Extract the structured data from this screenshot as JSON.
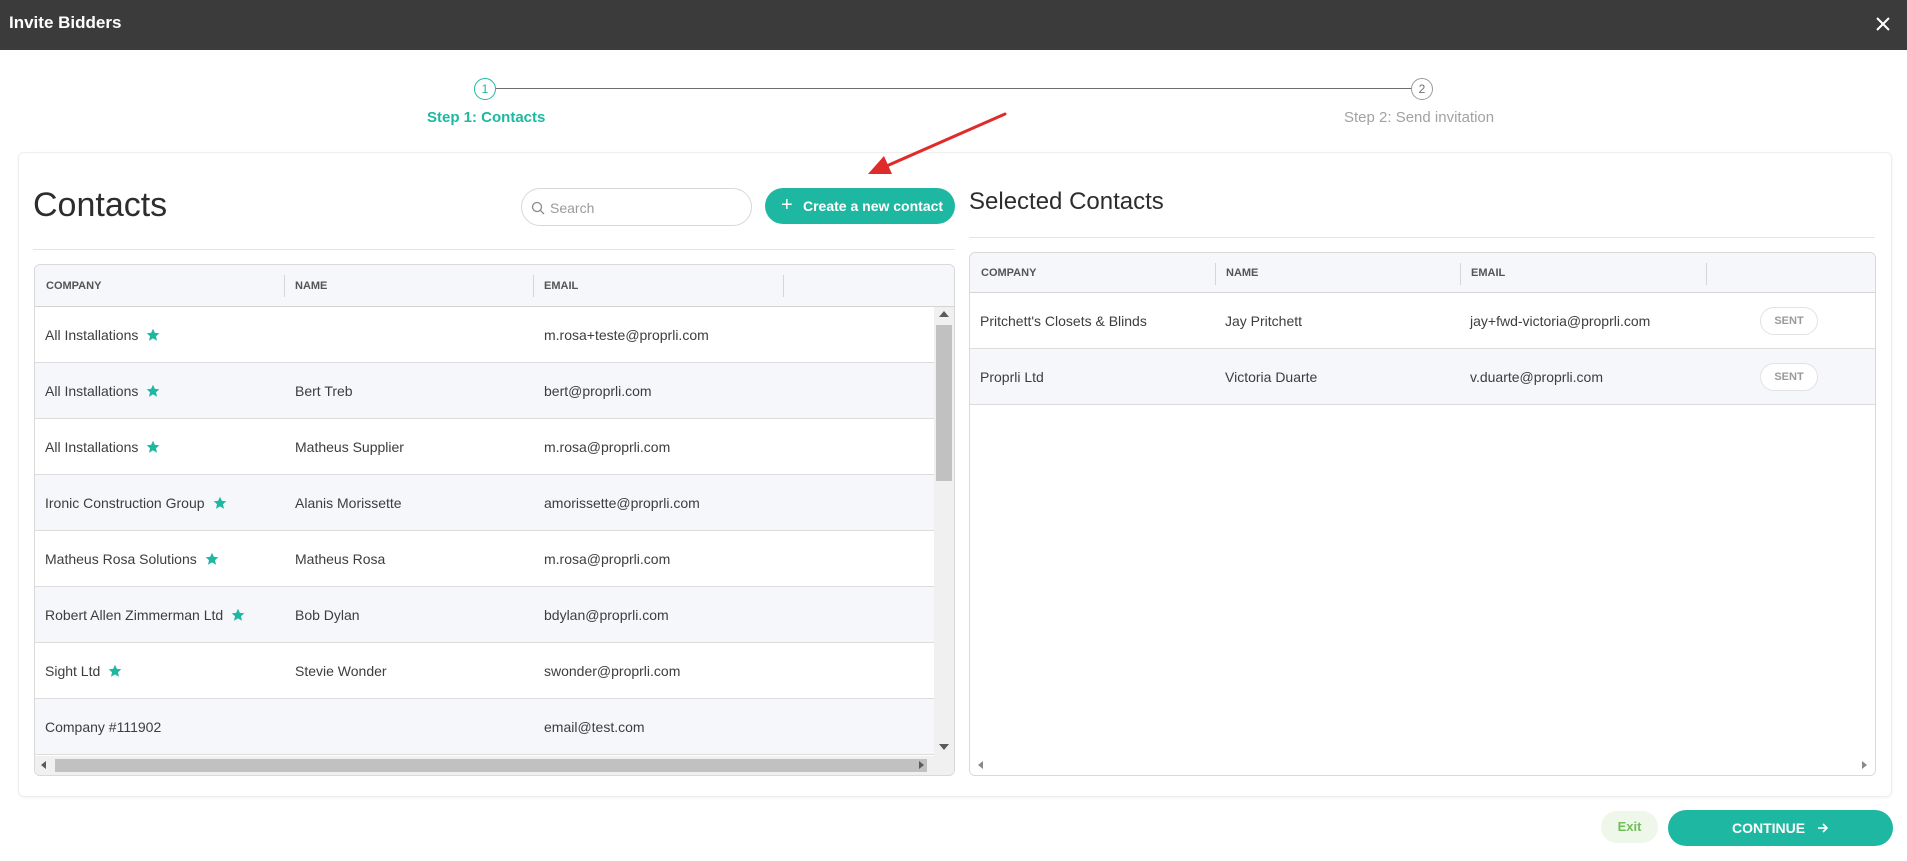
{
  "window": {
    "title": "Invite Bidders"
  },
  "stepper": {
    "steps": [
      {
        "number": "1",
        "label": "Step 1: Contacts",
        "active": true
      },
      {
        "number": "2",
        "label": "Step 2: Send invitation",
        "active": false
      }
    ]
  },
  "contacts": {
    "title": "Contacts",
    "search_placeholder": "Search",
    "create_button_label": "Create a new contact",
    "columns": [
      "COMPANY",
      "NAME",
      "EMAIL"
    ],
    "rows": [
      {
        "company": "All Installations",
        "starred": true,
        "name": "",
        "email": "m.rosa+teste@proprli.com"
      },
      {
        "company": "All Installations",
        "starred": true,
        "name": "Bert Treb",
        "email": "bert@proprli.com"
      },
      {
        "company": "All Installations",
        "starred": true,
        "name": "Matheus Supplier",
        "email": "m.rosa@proprli.com"
      },
      {
        "company": "Ironic Construction Group",
        "starred": true,
        "name": "Alanis Morissette",
        "email": "amorissette@proprli.com"
      },
      {
        "company": "Matheus Rosa Solutions",
        "starred": true,
        "name": "Matheus Rosa",
        "email": "m.rosa@proprli.com"
      },
      {
        "company": "Robert Allen Zimmerman Ltd",
        "starred": true,
        "name": "Bob Dylan",
        "email": "bdylan@proprli.com"
      },
      {
        "company": "Sight Ltd",
        "starred": true,
        "name": "Stevie Wonder",
        "email": "swonder@proprli.com"
      },
      {
        "company": "Company #111902",
        "starred": false,
        "name": "",
        "email": "email@test.com"
      }
    ]
  },
  "selected": {
    "title": "Selected Contacts",
    "columns": [
      "COMPANY",
      "NAME",
      "EMAIL",
      ""
    ],
    "rows": [
      {
        "company": "Pritchett's Closets & Blinds",
        "name": "Jay Pritchett",
        "email": "jay+fwd-victoria@proprli.com",
        "status": "SENT"
      },
      {
        "company": "Proprli Ltd",
        "name": "Victoria Duarte",
        "email": "v.duarte@proprli.com",
        "status": "SENT"
      }
    ]
  },
  "footer": {
    "exit_label": "Exit",
    "continue_label": "CONTINUE"
  },
  "colors": {
    "accent": "#1eb8a2",
    "titlebar": "#3b3b3b",
    "annotation_arrow": "#e02b2b",
    "exit_text": "#6fbf57"
  }
}
